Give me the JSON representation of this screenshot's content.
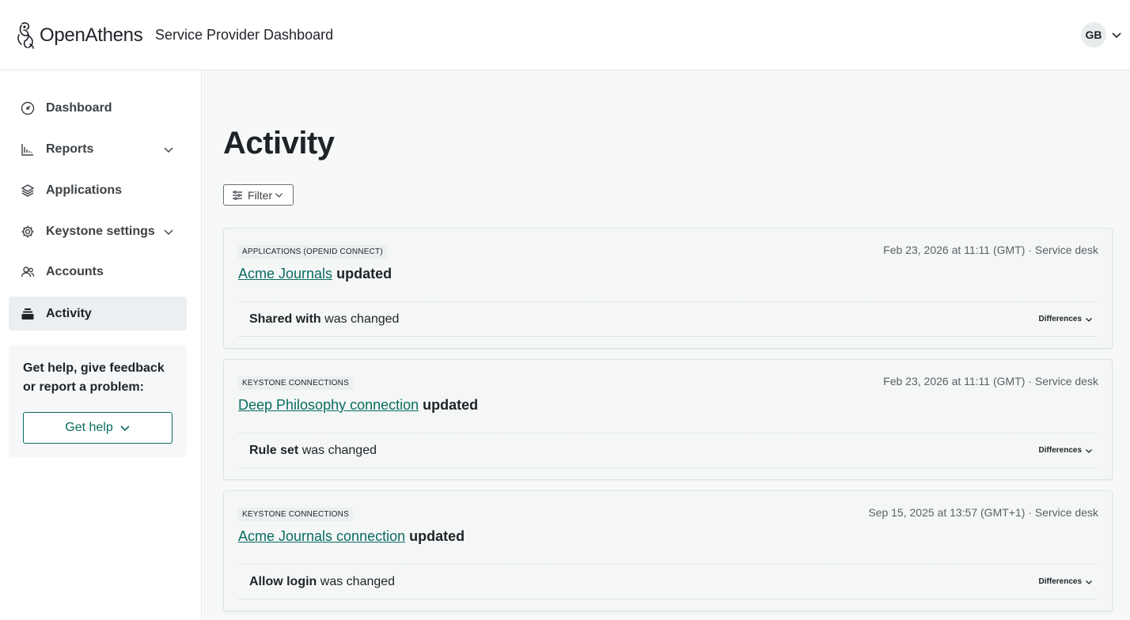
{
  "header": {
    "brand": "OpenAthens",
    "title": "Service Provider Dashboard",
    "user_initials": "GB"
  },
  "sidebar": {
    "items": [
      {
        "label": "Dashboard",
        "icon": "dashboard-gauge-icon",
        "has_chevron": false,
        "active": false
      },
      {
        "label": "Reports",
        "icon": "bar-chart-icon",
        "has_chevron": true,
        "active": false
      },
      {
        "label": "Applications",
        "icon": "layers-icon",
        "has_chevron": false,
        "active": false
      },
      {
        "label": "Keystone settings",
        "icon": "gear-icon",
        "has_chevron": true,
        "active": false
      },
      {
        "label": "Accounts",
        "icon": "users-icon",
        "has_chevron": false,
        "active": false
      },
      {
        "label": "Activity",
        "icon": "stack-icon",
        "has_chevron": false,
        "active": true
      }
    ],
    "help": {
      "text": "Get help, give feedback or report a problem:",
      "button_label": "Get help"
    }
  },
  "main": {
    "title": "Activity",
    "filter_label": "Filter",
    "activities": [
      {
        "tag": "APPLICATIONS (OPENID CONNECT)",
        "meta": "Feb 23, 2026 at 11:11 (GMT) · Service desk",
        "link": "Acme Journals",
        "action": "updated",
        "change_field": "Shared with",
        "change_suffix": "was changed",
        "diff_label": "Differences"
      },
      {
        "tag": "KEYSTONE CONNECTIONS",
        "meta": "Feb 23, 2026 at 11:11 (GMT) · Service desk",
        "link": "Deep Philosophy connection",
        "action": "updated",
        "change_field": "Rule set",
        "change_suffix": "was changed",
        "diff_label": "Differences"
      },
      {
        "tag": "KEYSTONE CONNECTIONS",
        "meta": "Sep 15, 2025 at 13:57 (GMT+1) · Service desk",
        "link": "Acme Journals connection",
        "action": "updated",
        "change_field": "Allow login",
        "change_suffix": "was changed",
        "diff_label": "Differences"
      }
    ]
  },
  "colors": {
    "accent": "#0a6b5f",
    "text": "#1f2328",
    "active_bg": "#ebeff1"
  }
}
